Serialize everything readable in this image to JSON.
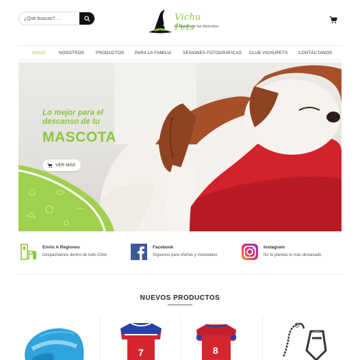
{
  "header": {
    "search_placeholder": "¿Qué buscas? ...",
    "logo_name": "Vichu Pets",
    "logo_tagline": "El Mundo de las Mascotas"
  },
  "nav": {
    "items": [
      {
        "label": "INICIO",
        "active": true
      },
      {
        "label": "NOSOTROS",
        "active": false
      },
      {
        "label": "PRODUCTOS",
        "active": false
      },
      {
        "label": "PARA LA FAMILIA",
        "active": false
      },
      {
        "label": "SESIONES FOTOGRÁFICAS",
        "active": false
      },
      {
        "label": "CLUB VICHUPETS",
        "active": false
      },
      {
        "label": "CONTÁCTANOS",
        "active": false
      }
    ]
  },
  "hero": {
    "line1": "Lo mejor para el",
    "line2": "descanso de tu",
    "big": "MASCOTA",
    "button_label": "VER MÁS"
  },
  "features": [
    {
      "icon": "delivery-icon",
      "title": "Envío A Regiones",
      "subtitle": "Despachamos dentro de todo Chile"
    },
    {
      "icon": "facebook-icon",
      "title": "Facebook",
      "subtitle": "Síguenos para ofertas y novedades"
    },
    {
      "icon": "instagram-icon",
      "title": "Instagram",
      "subtitle": "No te pierdas lo más destacado."
    }
  ],
  "products_section": {
    "title": "NUEVOS PRODUCTOS",
    "items": [
      {
        "icon": "blue-cap-image"
      },
      {
        "icon": "red-jersey-7-image",
        "number": "7"
      },
      {
        "icon": "red-jersey-8-image",
        "number": "8"
      },
      {
        "icon": "leash-image"
      }
    ]
  },
  "colors": {
    "accent": "#8cc63f",
    "dark": "#111111",
    "facebook": "#3b5998",
    "jersey_red": "#d7252f",
    "cushion_red": "#d2222c"
  }
}
